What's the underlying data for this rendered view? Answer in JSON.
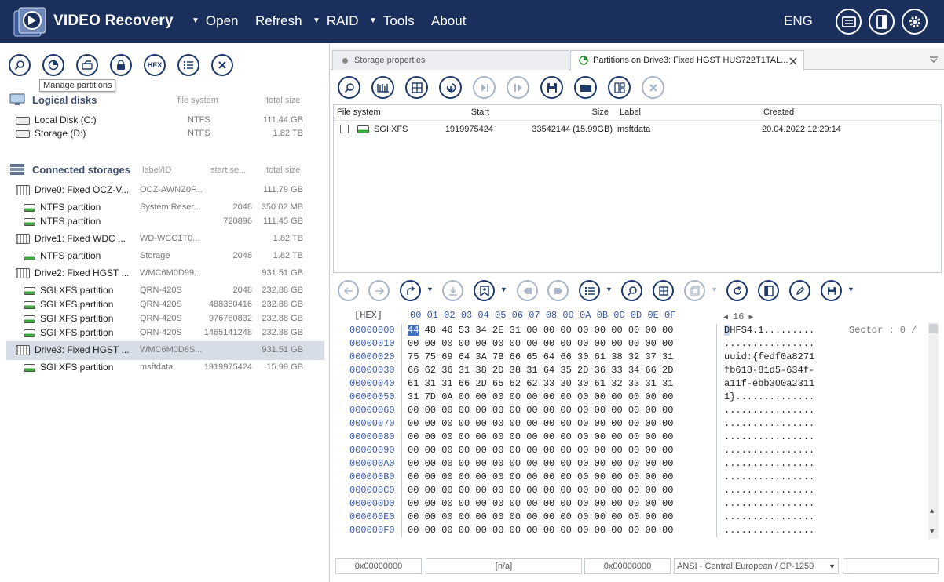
{
  "app": {
    "title": "VIDEO Recovery",
    "lang": "ENG"
  },
  "menu": [
    {
      "label": "Open",
      "has_arrow": true
    },
    {
      "label": "Refresh",
      "has_arrow": false
    },
    {
      "label": "RAID",
      "has_arrow": true
    },
    {
      "label": "Tools",
      "has_arrow": true
    },
    {
      "label": "About",
      "has_arrow": false
    }
  ],
  "left": {
    "tooltip": "Manage partitions",
    "hex_label": "HEX",
    "logical": {
      "title": "Logical disks",
      "col_fs": "file system",
      "col_size": "total size",
      "items": [
        {
          "name": "Local Disk (C:)",
          "fs": "NTFS",
          "size": "111.44 GB"
        },
        {
          "name": "Storage (D:)",
          "fs": "NTFS",
          "size": "1.82 TB"
        }
      ]
    },
    "connected": {
      "title": "Connected storages",
      "col_label": "label/ID",
      "col_start": "start se...",
      "col_size": "total size",
      "items": [
        {
          "kind": "drive",
          "name": "Drive0: Fixed OCZ-V...",
          "label": "OCZ-AWNZ0F...",
          "start": "",
          "size": "111.79 GB"
        },
        {
          "kind": "part",
          "name": "NTFS partition",
          "label": "System Reser...",
          "start": "2048",
          "size": "350.02 MB"
        },
        {
          "kind": "part",
          "name": "NTFS partition",
          "label": "",
          "start": "720896",
          "size": "111.45 GB"
        },
        {
          "kind": "drive",
          "name": "Drive1: Fixed WDC ...",
          "label": "WD-WCC1T0...",
          "start": "",
          "size": "1.82 TB"
        },
        {
          "kind": "part",
          "name": "NTFS partition",
          "label": "Storage",
          "start": "2048",
          "size": "1.82 TB"
        },
        {
          "kind": "drive",
          "name": "Drive2: Fixed HGST ...",
          "label": "WMC6M0D99...",
          "start": "",
          "size": "931.51 GB"
        },
        {
          "kind": "part",
          "name": "SGI XFS partition",
          "label": "QRN-420S",
          "start": "2048",
          "size": "232.88 GB"
        },
        {
          "kind": "part",
          "name": "SGI XFS partition",
          "label": "QRN-420S",
          "start": "488380416",
          "size": "232.88 GB"
        },
        {
          "kind": "part",
          "name": "SGI XFS partition",
          "label": "QRN-420S",
          "start": "976760832",
          "size": "232.88 GB"
        },
        {
          "kind": "part",
          "name": "SGI XFS partition",
          "label": "QRN-420S",
          "start": "1465141248",
          "size": "232.88 GB"
        },
        {
          "kind": "drive",
          "name": "Drive3: Fixed HGST ...",
          "label": "WMC6M0D8S...",
          "start": "",
          "size": "931.51 GB",
          "selected": true
        },
        {
          "kind": "part",
          "name": "SGI XFS partition",
          "label": "msftdata",
          "start": "1919975424",
          "size": "15.99 GB"
        }
      ]
    }
  },
  "tabs": [
    {
      "label": "Storage properties"
    },
    {
      "label": "Partitions on Drive3: Fixed HGST HUS722T1TAL..."
    }
  ],
  "partitions": {
    "headers": [
      "File system",
      "Start",
      "Size",
      "Label",
      "Created"
    ],
    "rows": [
      {
        "fs": "SGI XFS",
        "start": "1919975424",
        "size": "33542144 (15.99GB)",
        "label": "msftdata",
        "created": "20.04.2022 12:29:14"
      }
    ]
  },
  "hex": {
    "mode": "[HEX]",
    "col_header": "00 01 02 03 04 05 06 07 08 09 0A 0B 0C 0D 0E 0F",
    "width_label": "16",
    "sector_label": "Sector : 0 /",
    "offsets": [
      "00000000",
      "00000010",
      "00000020",
      "00000030",
      "00000040",
      "00000050",
      "00000060",
      "00000070",
      "00000080",
      "00000090",
      "000000A0",
      "000000B0",
      "000000C0",
      "000000D0",
      "000000E0",
      "000000F0"
    ],
    "bytes": [
      "44 48 46 53 34 2E 31 00 00 00 00 00 00 00 00 00",
      "00 00 00 00 00 00 00 00 00 00 00 00 00 00 00 00",
      "75 75 69 64 3A 7B 66 65 64 66 30 61 38 32 37 31",
      "66 62 36 31 38 2D 38 31 64 35 2D 36 33 34 66 2D",
      "61 31 31 66 2D 65 62 62 33 30 30 61 32 33 31 31",
      "31 7D 0A 00 00 00 00 00 00 00 00 00 00 00 00 00",
      "00 00 00 00 00 00 00 00 00 00 00 00 00 00 00 00",
      "00 00 00 00 00 00 00 00 00 00 00 00 00 00 00 00",
      "00 00 00 00 00 00 00 00 00 00 00 00 00 00 00 00",
      "00 00 00 00 00 00 00 00 00 00 00 00 00 00 00 00",
      "00 00 00 00 00 00 00 00 00 00 00 00 00 00 00 00",
      "00 00 00 00 00 00 00 00 00 00 00 00 00 00 00 00",
      "00 00 00 00 00 00 00 00 00 00 00 00 00 00 00 00",
      "00 00 00 00 00 00 00 00 00 00 00 00 00 00 00 00",
      "00 00 00 00 00 00 00 00 00 00 00 00 00 00 00 00",
      "00 00 00 00 00 00 00 00 00 00 00 00 00 00 00 00"
    ],
    "ascii": [
      "DHFS4.1.........",
      "................",
      "uuid:{fedf0a8271",
      "fb618-81d5-634f-",
      "a11f-ebb300a2311",
      "1}..............",
      "................",
      "................",
      "................",
      "................",
      "................",
      "................",
      "................",
      "................",
      "................",
      "................"
    ]
  },
  "status": {
    "offset": "0x00000000",
    "value": "[n/a]",
    "offset2": "0x00000000",
    "encoding": "ANSI - Central European / CP-1250"
  },
  "colors": {
    "topbar": "#1b2f5c",
    "icon": "#1d3a6b",
    "accent": "#3a58a8",
    "selected_row": "#d7dde6"
  }
}
